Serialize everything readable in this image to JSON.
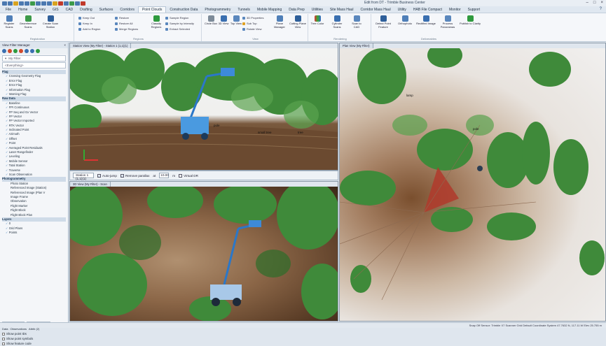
{
  "app": {
    "title": "Edit from DT - Trimble Business Center"
  },
  "menu": {
    "tabs": [
      "File",
      "Home",
      "Survey",
      "GIS",
      "CAD",
      "Drafting",
      "Surfaces",
      "Corridors",
      "Point Clouds",
      "Construction Data",
      "Photogrammetry",
      "Tunnels",
      "Mobile Mapping",
      "Data Prep",
      "Utilities",
      "Site Mass Haul",
      "Corridor Mass Haul",
      "Utility",
      "HAB File Compact",
      "Monitor",
      "Support"
    ],
    "active": "Point Clouds"
  },
  "ribbon": {
    "register": [
      "Register Scans",
      "Georeference Scans",
      "Create Scan Station"
    ],
    "regions": [
      "Keep Out",
      "Keep In",
      "Add to Region",
      "Restore",
      "Restore All",
      "Merge Regions",
      "Sample Region",
      "Sample by Intensity",
      "Extract Selected"
    ],
    "classify": "Classify Regions",
    "view": [
      "Circle Box",
      "3D View",
      "Top View",
      "3D Properties",
      "Sub Top",
      "Rotate View",
      "Plane Manager",
      "Cutting Plane View"
    ],
    "render": [
      "Tree Color",
      "Cylinder Scans",
      "Scan to CAD"
    ],
    "extract": [
      "Detect Point Feature",
      "Orthophoto",
      "Rectified Image",
      "Process Panoramas",
      "Publish to Clarity"
    ],
    "group_labels": [
      "Registration",
      "Regions",
      "View",
      "Rendering",
      "Deliverables"
    ]
  },
  "left_panel": {
    "title": "View Filter Manager",
    "filter_name": "My Filter",
    "search": "<Everything>",
    "tree": [
      {
        "type": "hdr",
        "label": "Flag"
      },
      {
        "type": "item",
        "label": "Crossing Geometry Flag"
      },
      {
        "type": "item",
        "label": "Error Flag"
      },
      {
        "type": "item",
        "label": "Error Flag"
      },
      {
        "type": "item",
        "label": "Information Flag"
      },
      {
        "type": "item",
        "label": "Warning Flag"
      },
      {
        "type": "hdr",
        "label": "Raw Data"
      },
      {
        "type": "item",
        "label": "Baseline"
      },
      {
        "type": "item",
        "label": "FPI Continuous"
      },
      {
        "type": "item",
        "label": "FP Seq and Gx Vector"
      },
      {
        "type": "item",
        "label": "FP Vector"
      },
      {
        "type": "item",
        "label": "FP Vector Imported"
      },
      {
        "type": "item",
        "label": "RTK Vector"
      },
      {
        "type": "item",
        "label": "Inclinated Point"
      },
      {
        "type": "item",
        "label": "Azimuth"
      },
      {
        "type": "item",
        "label": "Offset"
      },
      {
        "type": "item",
        "label": "Point"
      },
      {
        "type": "item",
        "label": "Averaged Point Residuals"
      },
      {
        "type": "item",
        "label": "Laser Rangefinder"
      },
      {
        "type": "item",
        "label": "Leveling"
      },
      {
        "type": "item",
        "label": "Mobile Sensor"
      },
      {
        "type": "item",
        "label": "Total Station"
      },
      {
        "type": "item",
        "label": "Traverse"
      },
      {
        "type": "item",
        "label": "Scan Observation"
      },
      {
        "type": "hdr",
        "label": "Photogrammetry"
      },
      {
        "type": "plain",
        "label": "Photo Station"
      },
      {
        "type": "plain",
        "label": "Referenced Image (Station)"
      },
      {
        "type": "plain",
        "label": "Referenced Image (Plan V"
      },
      {
        "type": "plain",
        "label": "Image Frame"
      },
      {
        "type": "plain",
        "label": "Observation"
      },
      {
        "type": "plain",
        "label": "Flight Marker"
      },
      {
        "type": "plain",
        "label": "Flight Block"
      },
      {
        "type": "plain",
        "label": "Flight Block Plan"
      },
      {
        "type": "hdr",
        "label": "Layers"
      },
      {
        "type": "item",
        "label": "0"
      },
      {
        "type": "item",
        "label": "Grid Plans"
      },
      {
        "type": "item",
        "label": "Points"
      }
    ],
    "bottom_tabs": [
      "Data",
      "Observations",
      "Attrib (2)"
    ],
    "options": [
      "Show point IDs",
      "Show point symbols",
      "Show feature code"
    ],
    "footer_tabs": [
      "Layer Explorer",
      "View Filter Man"
    ]
  },
  "views": {
    "top_tab": "Station View (My Filter) - Station 1 (1,1)(1)",
    "bottom_tab": "3D View (My Filter) - Scan",
    "right_tab": "Plan View (My Filter)"
  },
  "control_bar": {
    "station": "Station 1 (1,1)(1)",
    "auto_jump": "Auto-jump",
    "remove_parallax": "Remove parallax",
    "at_label": "at",
    "distance": "10.00",
    "unit": "m",
    "virtual_dr": "Virtual DR"
  },
  "annotations": {
    "lamp": "lamp",
    "pole": "pole",
    "small_tree": "small tree",
    "tree": "tree"
  },
  "status": "Snap  Off   Sensor: Trimble X7 Scanner  Grid  Default  Coordinate System   47.7632 N, 117.11 W  Elev  25.755 m"
}
